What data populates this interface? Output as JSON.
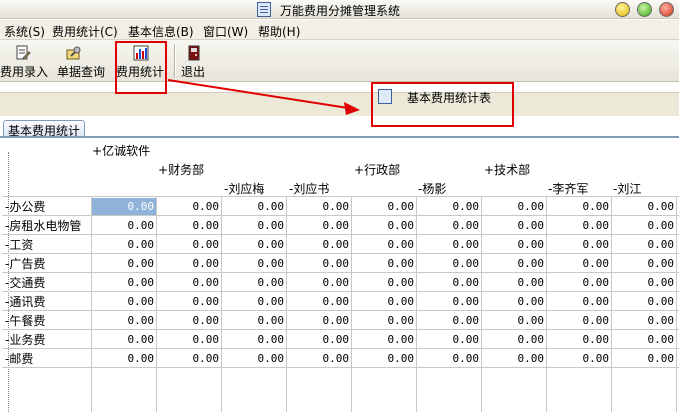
{
  "window": {
    "title": "万能费用分摊管理系统"
  },
  "menubar": [
    "系统(S)",
    "费用统计(C)",
    "基本信息(B)",
    "窗口(W)",
    "帮助(H)"
  ],
  "toolbar": {
    "items": [
      "费用录入",
      "单据查询",
      "费用统计",
      "退出"
    ]
  },
  "menu_card": "基本费用统计表",
  "child_tab": "基本费用统计",
  "grid": {
    "root": "亿诚软件",
    "departments": [
      "财务部",
      "行政部",
      "技术部"
    ],
    "persons": [
      "刘应梅",
      "刘应书",
      "杨影",
      "李齐军",
      "刘江"
    ],
    "rows": [
      "办公费",
      "房租水电物管",
      "工资",
      "广告费",
      "交通费",
      "通讯费",
      "午餐费",
      "业务费",
      "邮费"
    ],
    "value": "0.00"
  },
  "colors": {
    "annotation": "#e00000",
    "selected_cell": "#8fb2d9"
  }
}
